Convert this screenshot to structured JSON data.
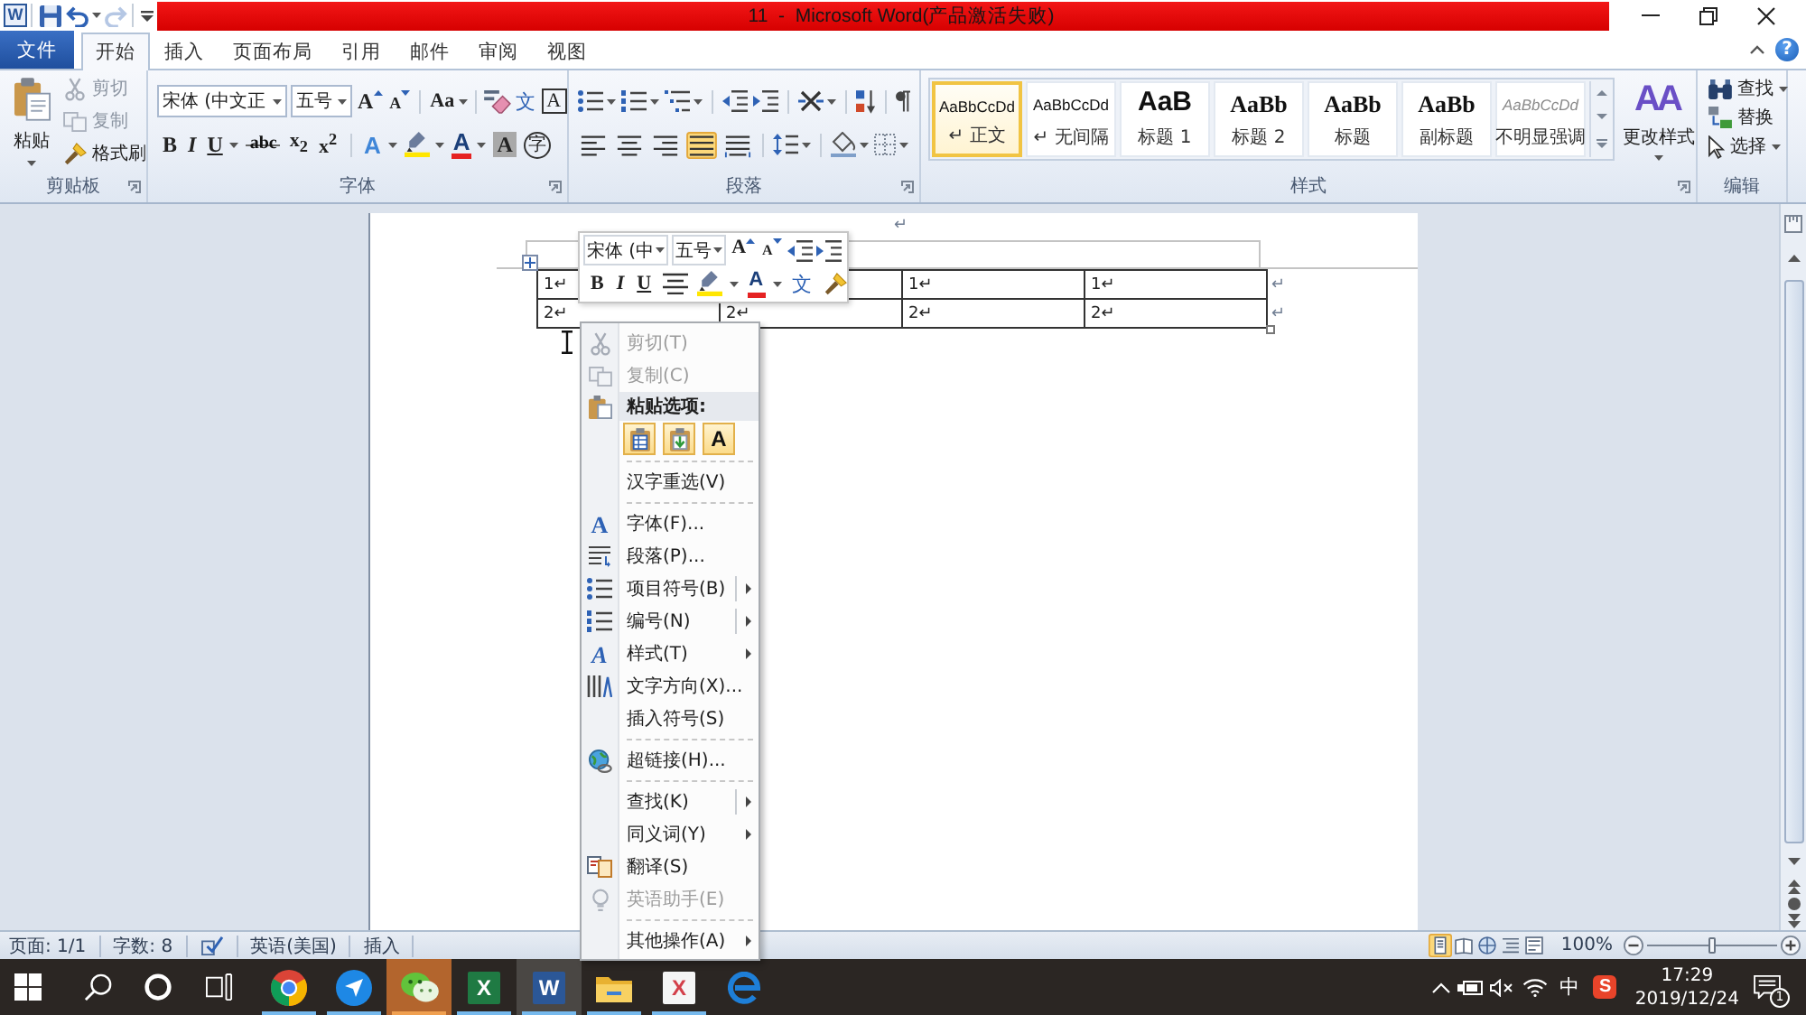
{
  "title_bar": {
    "app_logo": "W",
    "quick_access": [
      {
        "kind": "save",
        "disabled": false
      },
      {
        "kind": "undo",
        "disabled": false
      },
      {
        "kind": "redo",
        "disabled": true
      },
      {
        "kind": "customize",
        "disabled": false
      }
    ],
    "title": "11  -  Microsoft Word(产品激活失败)"
  },
  "tabs": [
    {
      "label": "文件",
      "kind": "file",
      "selected": false
    },
    {
      "label": "开始",
      "kind": "tab",
      "selected": true
    },
    {
      "label": "插入",
      "kind": "tab",
      "selected": false
    },
    {
      "label": "页面布局",
      "kind": "tab",
      "selected": false
    },
    {
      "label": "引用",
      "kind": "tab",
      "selected": false
    },
    {
      "label": "邮件",
      "kind": "tab",
      "selected": false
    },
    {
      "label": "审阅",
      "kind": "tab",
      "selected": false
    },
    {
      "label": "视图",
      "kind": "tab",
      "selected": false
    }
  ],
  "help_button": "?",
  "ribbon": {
    "clipboard": {
      "title": "剪贴板",
      "paste": "粘贴",
      "tools": [
        {
          "kind": "cut",
          "label": "剪切",
          "disabled": true
        },
        {
          "kind": "copy",
          "label": "复制",
          "disabled": true
        },
        {
          "kind": "painter",
          "label": "格式刷",
          "disabled": false
        }
      ]
    },
    "font": {
      "title": "字体",
      "font_name": "宋体 (中文正",
      "font_size": "五号",
      "row1": [
        [
          {
            "kind": "grow",
            "glyph": "A"
          },
          {
            "kind": "shrink",
            "glyph": "A"
          }
        ],
        [
          {
            "kind": "case",
            "glyph": "Aa"
          }
        ],
        [
          {
            "kind": "clear"
          },
          {
            "kind": "phonetic",
            "glyph": "文"
          },
          {
            "kind": "border",
            "glyph": "A"
          }
        ]
      ],
      "row2": [
        [
          {
            "kind": "bold",
            "glyph": "B"
          },
          {
            "kind": "italic",
            "glyph": "I"
          },
          {
            "kind": "underline",
            "glyph": "U"
          },
          {
            "kind": "strike",
            "glyph": "abc"
          },
          {
            "kind": "subscript",
            "glyph": "x$_{2}$"
          },
          {
            "kind": "superscript",
            "glyph": "x$^{2}$"
          }
        ],
        [
          {
            "kind": "effects",
            "glyph": "A"
          },
          {
            "kind": "highlight"
          },
          {
            "kind": "color",
            "glyph": "A"
          },
          {
            "kind": "shading",
            "glyph": "A"
          },
          {
            "kind": "enclose",
            "glyph": "字"
          }
        ]
      ]
    },
    "paragraph": {
      "title": "段落",
      "row1": [
        [
          {
            "kind": "bullets"
          },
          {
            "kind": "numbering"
          },
          {
            "kind": "multilevel"
          }
        ],
        [
          {
            "kind": "outdent"
          },
          {
            "kind": "indent"
          }
        ],
        [
          {
            "kind": "asian"
          }
        ],
        [
          {
            "kind": "sort"
          }
        ],
        [
          {
            "kind": "marks"
          }
        ]
      ],
      "alignment": [
        {
          "kind": "left",
          "selected": false
        },
        {
          "kind": "center",
          "selected": false
        },
        {
          "kind": "right",
          "selected": false
        },
        {
          "kind": "justify",
          "selected": true
        },
        {
          "kind": "distributed",
          "selected": false
        }
      ],
      "row2": [
        [
          {
            "kind": "spacing"
          }
        ],
        [
          {
            "kind": "fill"
          },
          {
            "kind": "borders"
          }
        ]
      ]
    },
    "styles": {
      "title": "样式",
      "items": [
        {
          "preview": "AaBbCcDd",
          "label": "↵ 正文",
          "kind": "normal",
          "selected": true
        },
        {
          "preview": "AaBbCcDd",
          "label": "↵ 无间隔",
          "kind": "normal",
          "selected": false
        },
        {
          "preview": "AaB",
          "label": "标题 1",
          "kind": "heading1",
          "selected": false
        },
        {
          "preview": "AaBb",
          "label": "标题 2",
          "kind": "heading2",
          "selected": false
        },
        {
          "preview": "AaBb",
          "label": "标题",
          "kind": "title",
          "selected": false
        },
        {
          "preview": "AaBb",
          "label": "副标题",
          "kind": "subtitle",
          "selected": false
        },
        {
          "preview": "AaBbCcDd",
          "label": "不明显强调",
          "kind": "emphasis",
          "selected": false
        }
      ],
      "change_styles": {
        "glyph": "AA",
        "label": "更改样式"
      }
    },
    "editing": {
      "title": "编辑",
      "tools": [
        {
          "kind": "find",
          "label": "查找"
        },
        {
          "kind": "replace",
          "label": "替换"
        },
        {
          "kind": "select",
          "label": "选择"
        }
      ]
    }
  },
  "document": {
    "paragraph_mark": "↵",
    "table": {
      "rows": [
        [
          "1↵",
          null,
          "1↵",
          "1↵"
        ],
        [
          "2↵",
          "2↵",
          "2↵",
          "2↵"
        ]
      ],
      "row_marks": [
        "↵",
        "↵"
      ]
    }
  },
  "mini_toolbar": {
    "font_name": "宋体 (中",
    "font_size": "五号",
    "row1": [
      {
        "kind": "grow",
        "glyph": "A"
      },
      {
        "kind": "shrink",
        "glyph": "A"
      },
      {
        "kind": "outdent"
      },
      {
        "kind": "indent"
      }
    ],
    "row2": [
      {
        "kind": "bold",
        "glyph": "B"
      },
      {
        "kind": "italic",
        "glyph": "I"
      },
      {
        "kind": "underline",
        "glyph": "U"
      },
      {
        "kind": "center"
      },
      {
        "kind": "highlight"
      },
      {
        "kind": "color",
        "glyph": "A"
      },
      {
        "kind": "phonetic",
        "glyph": "文"
      },
      {
        "kind": "painter"
      }
    ]
  },
  "context_menu": {
    "sections": [
      {
        "items": [
          {
            "kind": "cut",
            "label": "剪切(T)",
            "disabled": true,
            "submenu": false,
            "split": false
          },
          {
            "kind": "copy",
            "label": "复制(C)",
            "disabled": true,
            "submenu": false,
            "split": false
          },
          {
            "kind": "header",
            "label": "粘贴选项:",
            "disabled": false
          }
        ],
        "paste_options": [
          {
            "kind": "keep_source"
          },
          {
            "kind": "merge"
          },
          {
            "kind": "text_only",
            "glyph": "A"
          }
        ]
      },
      {
        "items": [
          {
            "kind": "plain",
            "label": "汉字重选(V)",
            "disabled": false,
            "submenu": false,
            "split": false
          }
        ]
      },
      {
        "items": [
          {
            "kind": "font",
            "glyph": "A",
            "label": "字体(F)...",
            "disabled": false,
            "submenu": false,
            "split": false
          },
          {
            "kind": "paragraph",
            "label": "段落(P)...",
            "disabled": false,
            "submenu": false,
            "split": false
          },
          {
            "kind": "bullets",
            "label": "项目符号(B)",
            "disabled": false,
            "submenu": true,
            "split": true
          },
          {
            "kind": "numbering",
            "label": "编号(N)",
            "disabled": false,
            "submenu": true,
            "split": true
          },
          {
            "kind": "styles",
            "glyph": "A",
            "label": "样式(T)",
            "disabled": false,
            "submenu": true,
            "split": false
          },
          {
            "kind": "direction",
            "label": "文字方向(X)...",
            "disabled": false,
            "submenu": false,
            "split": false
          },
          {
            "kind": "plain",
            "label": "插入符号(S)",
            "disabled": false,
            "submenu": false,
            "split": false
          }
        ]
      },
      {
        "items": [
          {
            "kind": "hyperlink",
            "label": "超链接(H)...",
            "disabled": false,
            "submenu": false,
            "split": false
          }
        ]
      },
      {
        "items": [
          {
            "kind": "plain",
            "label": "查找(K)",
            "disabled": false,
            "submenu": true,
            "split": true
          },
          {
            "kind": "plain",
            "label": "同义词(Y)",
            "disabled": false,
            "submenu": true,
            "split": false
          },
          {
            "kind": "translate",
            "label": "翻译(S)",
            "disabled": false,
            "submenu": false,
            "split": false
          },
          {
            "kind": "assistant",
            "label": "英语助手(E)",
            "disabled": true,
            "submenu": false,
            "split": false
          }
        ]
      },
      {
        "items": [
          {
            "kind": "plain",
            "label": "其他操作(A)",
            "disabled": false,
            "submenu": true,
            "split": false
          }
        ]
      }
    ]
  },
  "status_bar": {
    "page": "页面: 1/1",
    "words": "字数: 8",
    "language": "英语(美国)",
    "mode": "插入",
    "views": [
      {
        "kind": "print",
        "selected": true
      },
      {
        "kind": "reading",
        "selected": false
      },
      {
        "kind": "web",
        "selected": false
      },
      {
        "kind": "outline",
        "selected": false
      },
      {
        "kind": "draft",
        "selected": false
      }
    ],
    "zoom": "100%",
    "zoom_slider": {
      "level": 0.5
    }
  },
  "taskbar": {
    "system": [
      {
        "kind": "start"
      },
      {
        "kind": "search"
      },
      {
        "kind": "cortana"
      },
      {
        "kind": "task_view"
      }
    ],
    "apps": [
      {
        "kind": "chrome",
        "running": true,
        "selected": false,
        "attention": false
      },
      {
        "kind": "plane",
        "running": true,
        "selected": false,
        "attention": false
      },
      {
        "kind": "wechat",
        "running": true,
        "selected": false,
        "attention": true
      },
      {
        "kind": "excel",
        "glyph": "X",
        "running": true,
        "selected": false,
        "attention": false
      },
      {
        "kind": "word",
        "glyph": "W",
        "running": true,
        "selected": true,
        "attention": false
      },
      {
        "kind": "folder",
        "running": true,
        "selected": false,
        "attention": false
      },
      {
        "kind": "xmind",
        "glyph": "X",
        "running": true,
        "selected": false,
        "attention": false
      },
      {
        "kind": "edge",
        "running": false,
        "selected": false,
        "attention": false
      }
    ],
    "tray": [
      {
        "kind": "chevron"
      },
      {
        "kind": "power"
      },
      {
        "kind": "muted"
      },
      {
        "kind": "wifi"
      }
    ],
    "ime": "中",
    "sogou": "S",
    "time": "17:29",
    "date": "2019/12/24",
    "notifications": "1"
  }
}
